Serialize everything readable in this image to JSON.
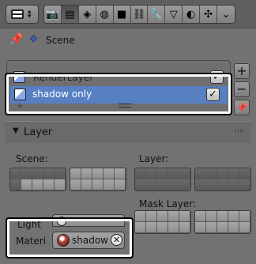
{
  "header": {
    "context_icons": [
      {
        "name": "render-icon",
        "glyph": "📷"
      },
      {
        "name": "render-layers-icon",
        "glyph": "▤"
      },
      {
        "name": "scene-icon",
        "glyph": "◈"
      },
      {
        "name": "world-icon",
        "glyph": "◍"
      },
      {
        "name": "object-icon",
        "glyph": "■"
      },
      {
        "name": "constraints-icon",
        "glyph": "⛓"
      },
      {
        "name": "modifiers-icon",
        "glyph": "🔧"
      },
      {
        "name": "data-icon",
        "glyph": "▽"
      },
      {
        "name": "material-icon",
        "glyph": "◐"
      },
      {
        "name": "particles-icon",
        "glyph": "✣"
      },
      {
        "name": "physics-icon",
        "glyph": "⌄"
      }
    ],
    "active_index": 1
  },
  "breadcrumb": {
    "pin_glyph": "📌",
    "scene_glyph": "❖",
    "label": "Scene"
  },
  "render_layers": {
    "items": [
      {
        "label": "RenderLayer",
        "checked": true
      },
      {
        "label": "shadow only",
        "checked": true,
        "selected": true
      }
    ],
    "check_glyph": "✓",
    "add_glyph": "+",
    "remove_glyph": "−",
    "pin_glyph": "📌"
  },
  "layer_panel": {
    "title": "Layer",
    "collapse_glyph": "▼",
    "scene_label": "Scene:",
    "layer_label": "Layer:",
    "mask_layer_label": "Mask Layer:",
    "light_label": "Light",
    "material_label": "Materi",
    "material_value": "shadow",
    "clear_glyph": "✕"
  },
  "colors": {
    "selection": "#5680c2",
    "background": "#727272",
    "header": "#5f5f5f",
    "highlight_frame": "#ffffff"
  }
}
